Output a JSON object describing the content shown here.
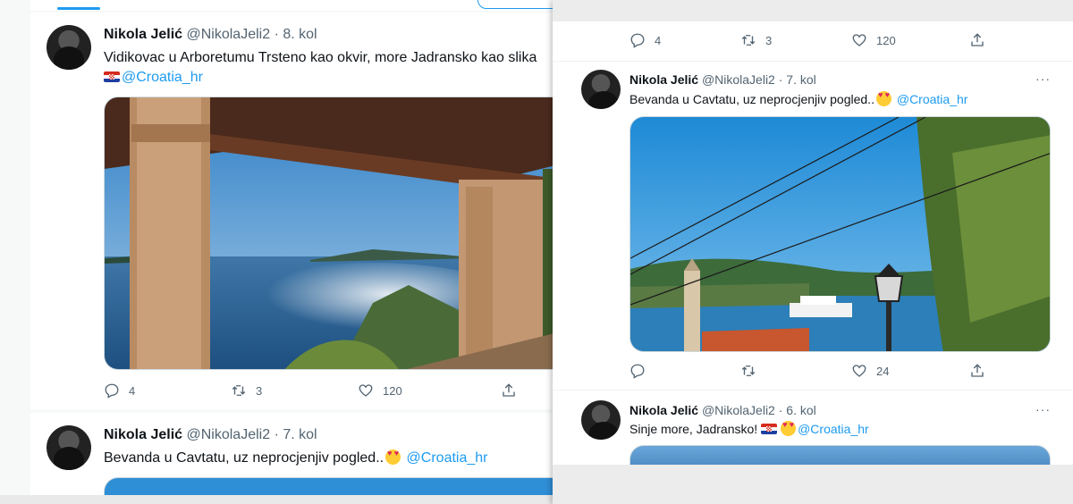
{
  "left": {
    "tweet1": {
      "name": "Nikola Jelić",
      "handle": "@NikolaJeli2",
      "date": "· 8. kol",
      "text": "Vidikovac u Arboretumu Trsteno kao okvir, more Jadransko kao slika",
      "mention": "@Croatia_hr",
      "replies": "4",
      "retweets": "3",
      "likes": "120"
    },
    "tweet2": {
      "name": "Nikola Jelić",
      "handle": "@NikolaJeli2",
      "date": "· 7. kol",
      "text": "Bevanda u Cavtatu, uz neprocjenjiv pogled..",
      "mention": "@Croatia_hr"
    }
  },
  "right": {
    "top_actions": {
      "replies": "4",
      "retweets": "3",
      "likes": "120"
    },
    "tweet1": {
      "name": "Nikola Jelić",
      "handle": "@NikolaJeli2",
      "date": "· 7. kol",
      "text": "Bevanda u Cavtatu, uz neprocjenjiv pogled..",
      "mention": "@Croatia_hr",
      "likes": "24",
      "more": "···"
    },
    "tweet2": {
      "name": "Nikola Jelić",
      "handle": "@NikolaJeli2",
      "date": "· 6. kol",
      "text": "Sinje more, Jadransko!",
      "mention": "@Croatia_hr",
      "more": "···"
    }
  },
  "icons": [
    "reply-icon",
    "retweet-icon",
    "like-icon",
    "share-icon",
    "more-icon",
    "croatia-flag-icon",
    "heart-eyes-emoji-icon"
  ],
  "colors": {
    "accent": "#1d9bf0",
    "text": "#0f1419",
    "secondary": "#536471"
  }
}
